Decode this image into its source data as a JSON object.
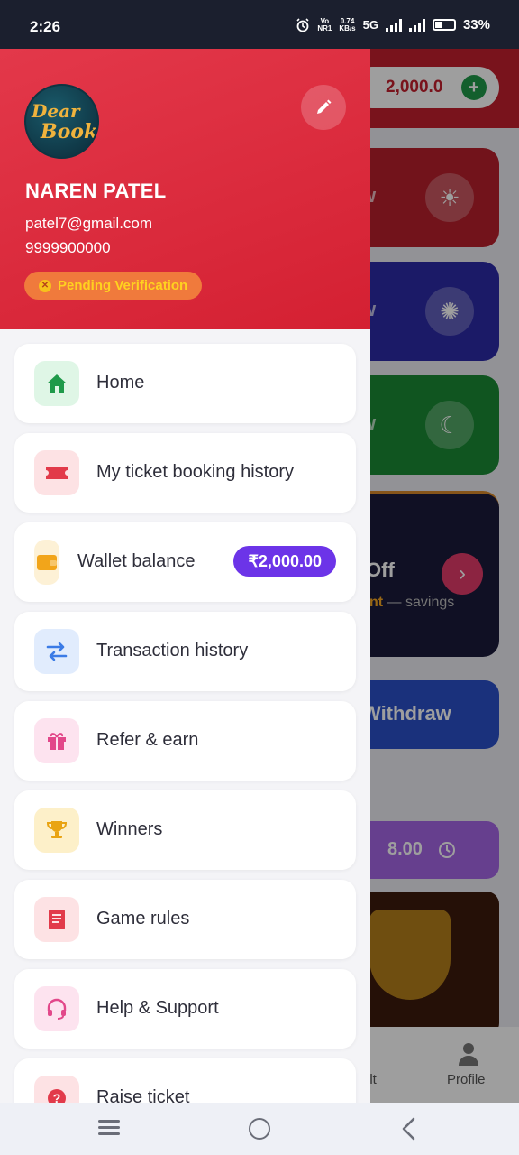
{
  "status_bar": {
    "time": "2:26",
    "network_speed": "0.74",
    "network_unit": "KB/s",
    "network_type": "5G",
    "battery": "33%"
  },
  "background": {
    "wallet_amount": "2,000.0",
    "card_fragment": "w",
    "offer_title": "Off",
    "offer_sub_highlight": "nt",
    "offer_sub": " — savings",
    "withdraw": "Withdraw",
    "timer": "8.00",
    "nav_result": "ult",
    "nav_profile": "Profile"
  },
  "drawer": {
    "logo_line1": "Dear",
    "logo_line2": "Book",
    "user_name": "NAREN PATEL",
    "email": "patel7@gmail.com",
    "phone": "9999900000",
    "verification_status": "Pending Verification",
    "menu": [
      {
        "label": "Home",
        "icon": "home-icon",
        "color": "#1f9a4a",
        "bg": "#dff6e6"
      },
      {
        "label": "My ticket booking history",
        "icon": "ticket-icon",
        "color": "#e23a4a",
        "bg": "#fde2e4"
      },
      {
        "label": "Wallet balance",
        "icon": "wallet-icon",
        "color": "#f2a51a",
        "bg": "#fdf1d6",
        "badge": "₹2,000.00"
      },
      {
        "label": "Transaction history",
        "icon": "swap-arrows-icon",
        "color": "#3b7be6",
        "bg": "#e1ecfd"
      },
      {
        "label": "Refer & earn",
        "icon": "gift-icon",
        "color": "#e2488a",
        "bg": "#fde3ef"
      },
      {
        "label": "Winners",
        "icon": "trophy-icon",
        "color": "#e9a413",
        "bg": "#fdf0c9"
      },
      {
        "label": "Game rules",
        "icon": "rulebook-icon",
        "color": "#e23a4a",
        "bg": "#fde2e4"
      },
      {
        "label": "Help & Support",
        "icon": "headset-icon",
        "color": "#e2488a",
        "bg": "#fde3ef"
      },
      {
        "label": "Raise ticket",
        "icon": "question-icon",
        "color": "#e23a4a",
        "bg": "#fde2e4"
      }
    ]
  },
  "colors": {
    "header_red": "#d42032",
    "badge_purple": "#6c34e8",
    "pending_orange": "#f07a3c"
  }
}
